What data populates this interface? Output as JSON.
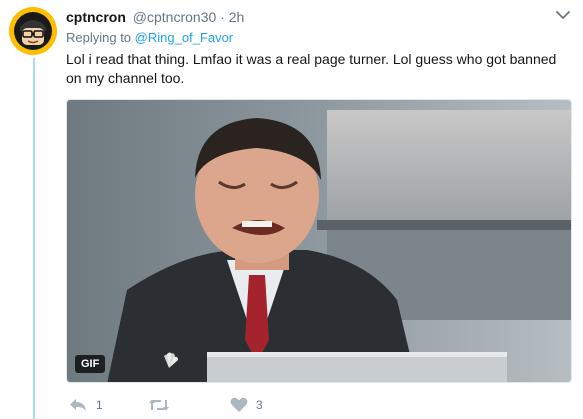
{
  "tweet": {
    "display_name": "cptncron",
    "handle": "@cptncron30",
    "separator": "·",
    "timestamp": "2h",
    "replying_to_prefix": "Replying to",
    "replying_to_handle": "@Ring_of_Favor",
    "text": "Lol i read that thing. Lmfao it was a real page turner. Lol guess who got banned on my channel too.",
    "media_badge": "GIF",
    "reply_count": "1",
    "retweet_count": "",
    "like_count": "3"
  },
  "icons": {
    "caret": "chevron-down-icon",
    "reply": "reply-icon",
    "retweet": "retweet-icon",
    "like": "heart-icon",
    "network_logo": "peacock-logo"
  },
  "colors": {
    "link": "#1da1f2",
    "muted": "#657786",
    "thread_line": "#a9daf7",
    "avatar_bg": "#ffbf00"
  }
}
